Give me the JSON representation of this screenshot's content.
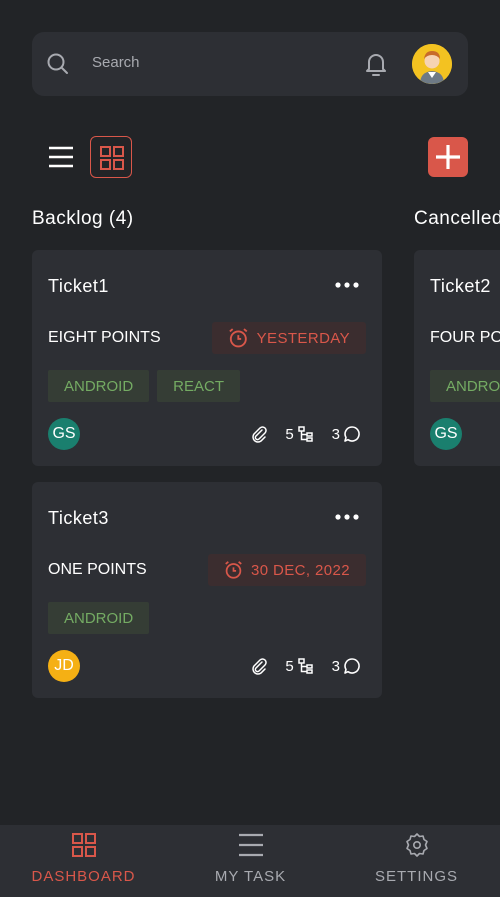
{
  "search": {
    "placeholder": "Search"
  },
  "toolbar": {
    "list_view": "list-view",
    "grid_view": "grid-view",
    "add": "add-ticket"
  },
  "columns": [
    {
      "title": "Backlog (4)",
      "cards": [
        {
          "title": "Ticket1",
          "points": "EIGHT POINTS",
          "due": "YESTERDAY",
          "tags": [
            "ANDROID",
            "REACT"
          ],
          "assignee": "GS",
          "attachments": "",
          "subtasks": "5",
          "comments": "3"
        },
        {
          "title": "Ticket3",
          "points": "ONE POINTS",
          "due": "30 DEC, 2022",
          "tags": [
            "ANDROID"
          ],
          "assignee": "JD",
          "attachments": "",
          "subtasks": "5",
          "comments": "3"
        }
      ]
    },
    {
      "title": "Cancelled",
      "cards": [
        {
          "title": "Ticket2",
          "points": "FOUR PO",
          "tags": [
            "ANDRO"
          ],
          "assignee": "GS"
        }
      ]
    }
  ],
  "nav": {
    "items": [
      {
        "label": "DASHBOARD",
        "icon": "grid-icon",
        "active": true
      },
      {
        "label": "MY TASK",
        "icon": "menu-icon",
        "active": false
      },
      {
        "label": "SETTINGS",
        "icon": "gear-icon",
        "active": false
      }
    ]
  },
  "colors": {
    "accent": "#d9574a",
    "background": "#222427",
    "surface": "#2d2f34",
    "tag_text": "#74ab63",
    "avatar_gs": "#1a7f6e",
    "avatar_jd": "#f5b014"
  }
}
